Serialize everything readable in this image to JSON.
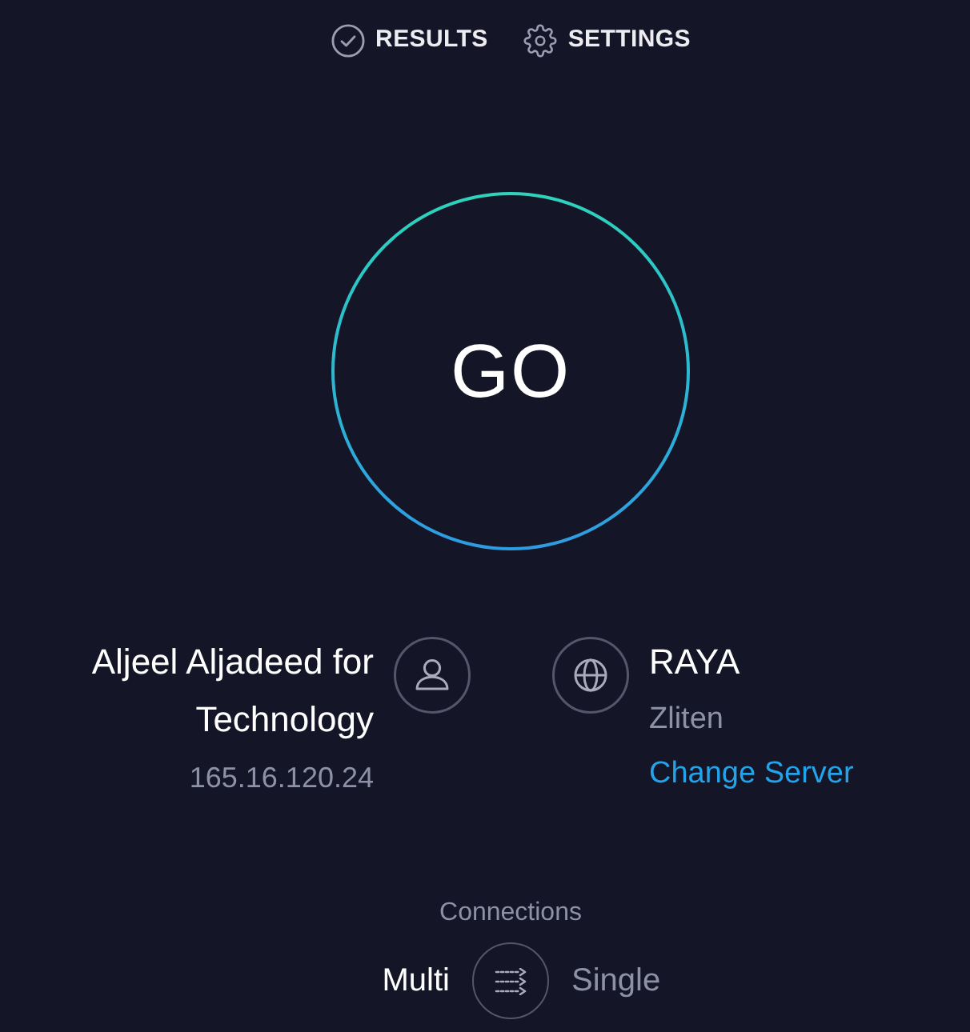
{
  "nav": [
    {
      "label": "RESULTS"
    },
    {
      "label": "SETTINGS"
    }
  ],
  "start_button": {
    "label": "GO"
  },
  "provider": {
    "name": "Aljeel Aljadeed for Technology",
    "ip": "165.16.120.24"
  },
  "server": {
    "name": "RAYA",
    "location": "Zliten",
    "change_link": "Change Server"
  },
  "connections": {
    "label": "Connections",
    "options": [
      {
        "label": "Multi",
        "selected": true
      },
      {
        "label": "Single",
        "selected": false
      }
    ]
  }
}
